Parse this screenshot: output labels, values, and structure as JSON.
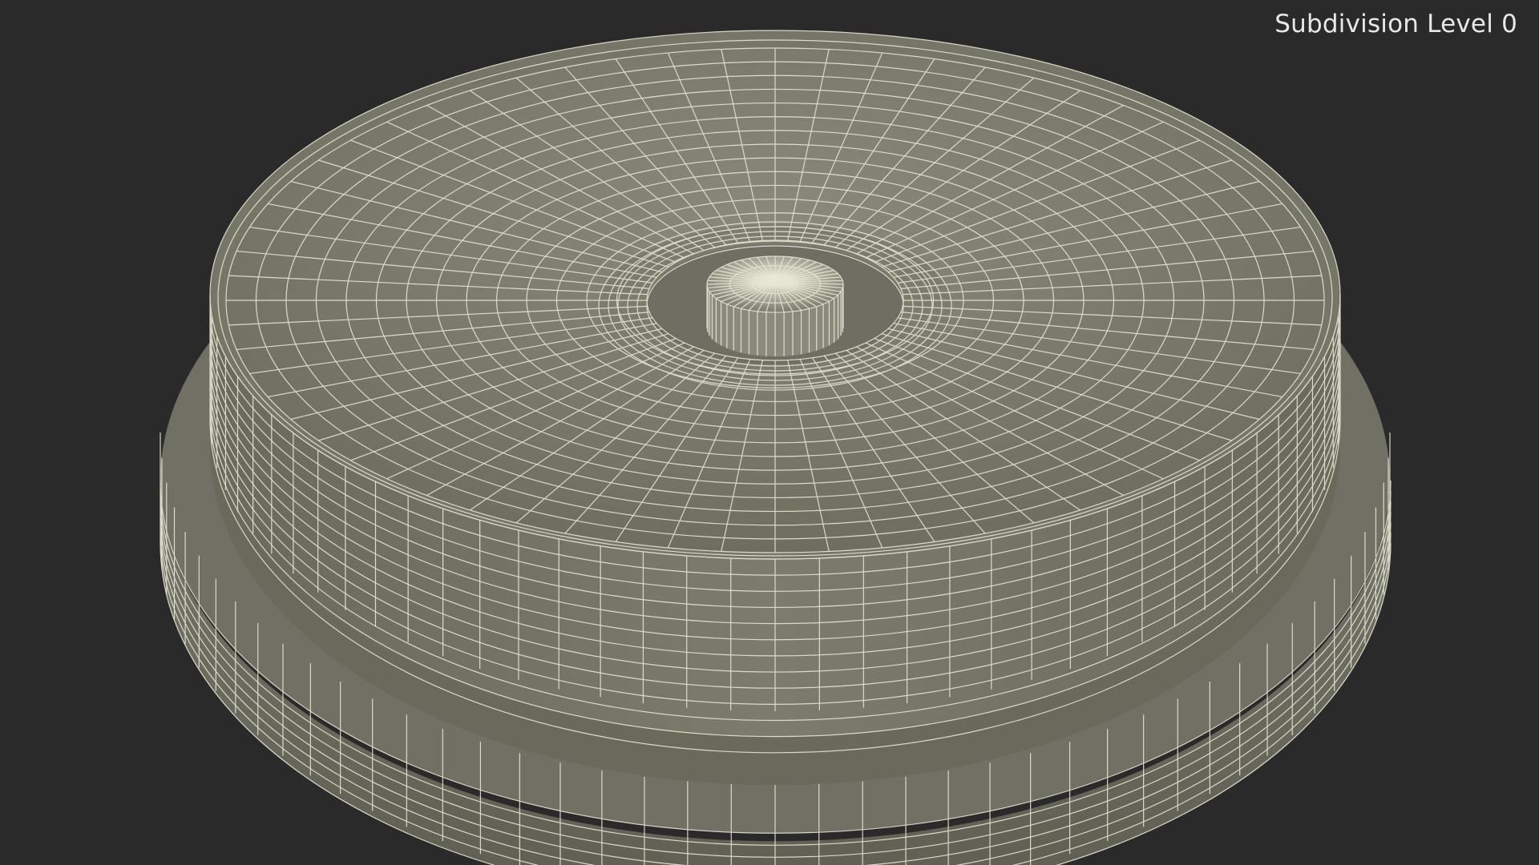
{
  "viewport": {
    "overlay_label": "Subdivision Level 0",
    "background_color": "#2a2a2a",
    "surface_color": "#7a7a6a",
    "wire_color": "#e8e6d4"
  },
  "model": {
    "object": "round-pan-with-center-post",
    "display_mode": "wireframe-on-shaded"
  }
}
